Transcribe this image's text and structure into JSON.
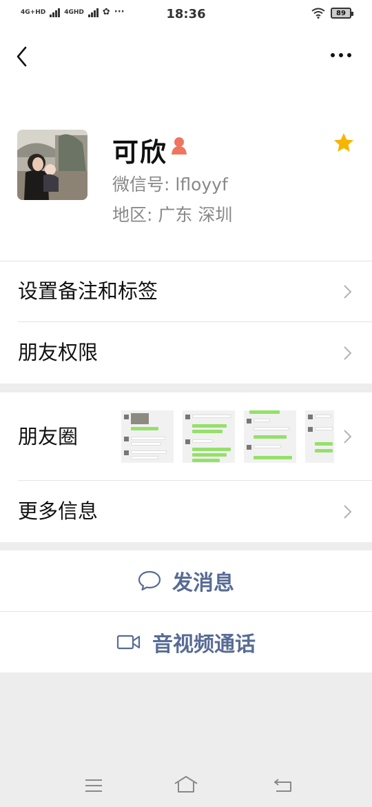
{
  "status_bar": {
    "network1": "4G+HD",
    "network2": "4GHD",
    "time": "18:36",
    "battery": "89"
  },
  "profile": {
    "name": "可欣",
    "wechat_id": "微信号: lfloyyf",
    "region": "地区: 广东  深圳"
  },
  "menu": {
    "set_remark": "设置备注和标签",
    "friend_permission": "朋友权限",
    "moments": "朋友圈",
    "more_info": "更多信息"
  },
  "actions": {
    "send_message": "发消息",
    "video_call": "音视频通话"
  },
  "colors": {
    "accent": "#576b95",
    "star": "#f7b500",
    "gender_female": "#f07560"
  }
}
